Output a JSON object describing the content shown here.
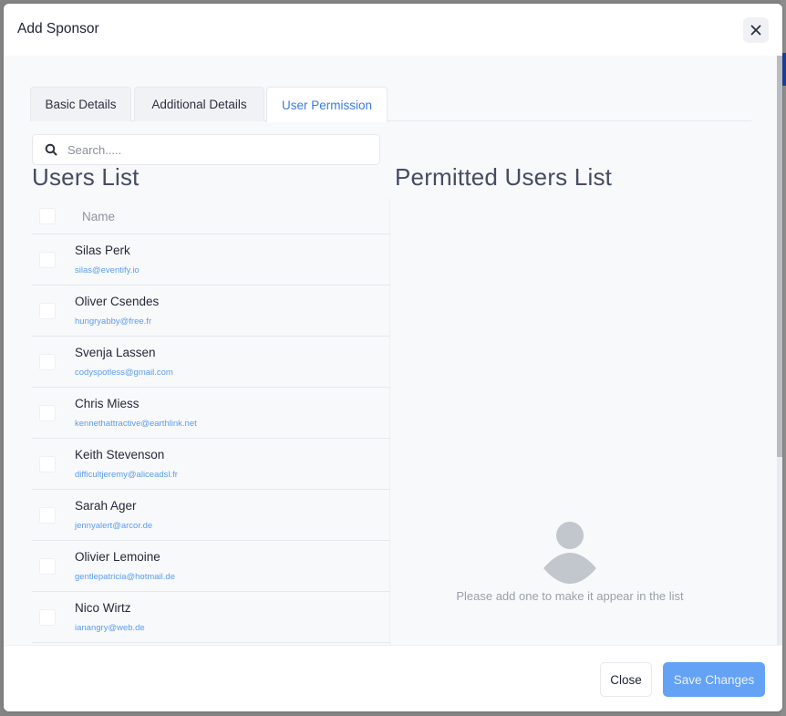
{
  "modal": {
    "title": "Add Sponsor",
    "close_icon": "close-icon"
  },
  "tabs": [
    {
      "label": "Basic Details",
      "active": false
    },
    {
      "label": "Additional Details",
      "active": false
    },
    {
      "label": "User Permission",
      "active": true
    }
  ],
  "search": {
    "placeholder": "Search.....",
    "value": "",
    "icon": "search-icon"
  },
  "users_list": {
    "title": "Users List",
    "column_header": "Name",
    "users": [
      {
        "name": "Silas Perk",
        "email": "silas@eventify.io",
        "checked": false
      },
      {
        "name": "Oliver Csendes",
        "email": "hungryabby@free.fr",
        "checked": false
      },
      {
        "name": "Svenja Lassen",
        "email": "codyspotless@gmail.com",
        "checked": false
      },
      {
        "name": "Chris Miess",
        "email": "kennethattractive@earthlink.net",
        "checked": false
      },
      {
        "name": "Keith Stevenson",
        "email": "difficultjeremy@aliceadsl.fr",
        "checked": false
      },
      {
        "name": "Sarah Ager",
        "email": "jennyalert@arcor.de",
        "checked": false
      },
      {
        "name": "Olivier Lemoine",
        "email": "gentlepatricia@hotmail.de",
        "checked": false
      },
      {
        "name": "Nico Wirtz",
        "email": "ianangry@web.de",
        "checked": false
      }
    ]
  },
  "permitted_list": {
    "title": "Permitted Users List",
    "empty_icon": "user-placeholder-icon",
    "empty_message": "Please add one to make it appear in the list"
  },
  "footer": {
    "close_label": "Close",
    "save_label": "Save Changes"
  },
  "colors": {
    "accent": "#3a7be0",
    "save_button": "#64a2f5",
    "email_link": "#5b9cf0",
    "body_background": "#f8f9fb"
  }
}
